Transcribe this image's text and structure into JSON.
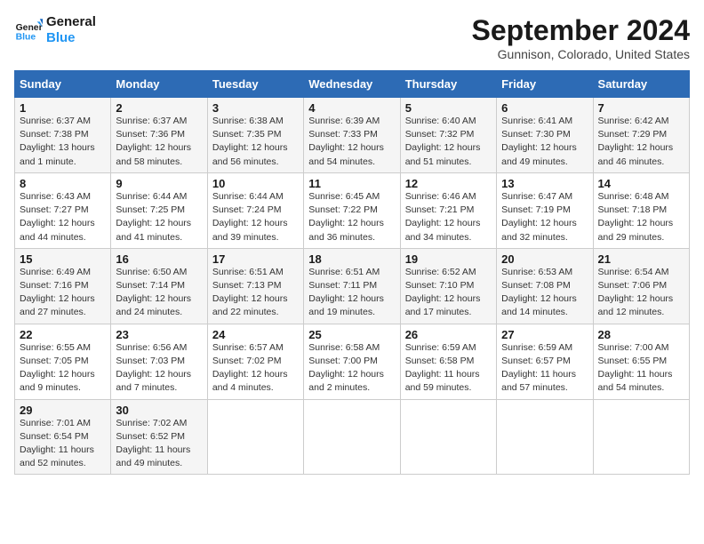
{
  "header": {
    "logo_general": "General",
    "logo_blue": "Blue",
    "title": "September 2024",
    "subtitle": "Gunnison, Colorado, United States"
  },
  "days_of_week": [
    "Sunday",
    "Monday",
    "Tuesday",
    "Wednesday",
    "Thursday",
    "Friday",
    "Saturday"
  ],
  "weeks": [
    [
      {
        "num": "1",
        "sunrise": "Sunrise: 6:37 AM",
        "sunset": "Sunset: 7:38 PM",
        "daylight": "Daylight: 13 hours and 1 minute."
      },
      {
        "num": "2",
        "sunrise": "Sunrise: 6:37 AM",
        "sunset": "Sunset: 7:36 PM",
        "daylight": "Daylight: 12 hours and 58 minutes."
      },
      {
        "num": "3",
        "sunrise": "Sunrise: 6:38 AM",
        "sunset": "Sunset: 7:35 PM",
        "daylight": "Daylight: 12 hours and 56 minutes."
      },
      {
        "num": "4",
        "sunrise": "Sunrise: 6:39 AM",
        "sunset": "Sunset: 7:33 PM",
        "daylight": "Daylight: 12 hours and 54 minutes."
      },
      {
        "num": "5",
        "sunrise": "Sunrise: 6:40 AM",
        "sunset": "Sunset: 7:32 PM",
        "daylight": "Daylight: 12 hours and 51 minutes."
      },
      {
        "num": "6",
        "sunrise": "Sunrise: 6:41 AM",
        "sunset": "Sunset: 7:30 PM",
        "daylight": "Daylight: 12 hours and 49 minutes."
      },
      {
        "num": "7",
        "sunrise": "Sunrise: 6:42 AM",
        "sunset": "Sunset: 7:29 PM",
        "daylight": "Daylight: 12 hours and 46 minutes."
      }
    ],
    [
      {
        "num": "8",
        "sunrise": "Sunrise: 6:43 AM",
        "sunset": "Sunset: 7:27 PM",
        "daylight": "Daylight: 12 hours and 44 minutes."
      },
      {
        "num": "9",
        "sunrise": "Sunrise: 6:44 AM",
        "sunset": "Sunset: 7:25 PM",
        "daylight": "Daylight: 12 hours and 41 minutes."
      },
      {
        "num": "10",
        "sunrise": "Sunrise: 6:44 AM",
        "sunset": "Sunset: 7:24 PM",
        "daylight": "Daylight: 12 hours and 39 minutes."
      },
      {
        "num": "11",
        "sunrise": "Sunrise: 6:45 AM",
        "sunset": "Sunset: 7:22 PM",
        "daylight": "Daylight: 12 hours and 36 minutes."
      },
      {
        "num": "12",
        "sunrise": "Sunrise: 6:46 AM",
        "sunset": "Sunset: 7:21 PM",
        "daylight": "Daylight: 12 hours and 34 minutes."
      },
      {
        "num": "13",
        "sunrise": "Sunrise: 6:47 AM",
        "sunset": "Sunset: 7:19 PM",
        "daylight": "Daylight: 12 hours and 32 minutes."
      },
      {
        "num": "14",
        "sunrise": "Sunrise: 6:48 AM",
        "sunset": "Sunset: 7:18 PM",
        "daylight": "Daylight: 12 hours and 29 minutes."
      }
    ],
    [
      {
        "num": "15",
        "sunrise": "Sunrise: 6:49 AM",
        "sunset": "Sunset: 7:16 PM",
        "daylight": "Daylight: 12 hours and 27 minutes."
      },
      {
        "num": "16",
        "sunrise": "Sunrise: 6:50 AM",
        "sunset": "Sunset: 7:14 PM",
        "daylight": "Daylight: 12 hours and 24 minutes."
      },
      {
        "num": "17",
        "sunrise": "Sunrise: 6:51 AM",
        "sunset": "Sunset: 7:13 PM",
        "daylight": "Daylight: 12 hours and 22 minutes."
      },
      {
        "num": "18",
        "sunrise": "Sunrise: 6:51 AM",
        "sunset": "Sunset: 7:11 PM",
        "daylight": "Daylight: 12 hours and 19 minutes."
      },
      {
        "num": "19",
        "sunrise": "Sunrise: 6:52 AM",
        "sunset": "Sunset: 7:10 PM",
        "daylight": "Daylight: 12 hours and 17 minutes."
      },
      {
        "num": "20",
        "sunrise": "Sunrise: 6:53 AM",
        "sunset": "Sunset: 7:08 PM",
        "daylight": "Daylight: 12 hours and 14 minutes."
      },
      {
        "num": "21",
        "sunrise": "Sunrise: 6:54 AM",
        "sunset": "Sunset: 7:06 PM",
        "daylight": "Daylight: 12 hours and 12 minutes."
      }
    ],
    [
      {
        "num": "22",
        "sunrise": "Sunrise: 6:55 AM",
        "sunset": "Sunset: 7:05 PM",
        "daylight": "Daylight: 12 hours and 9 minutes."
      },
      {
        "num": "23",
        "sunrise": "Sunrise: 6:56 AM",
        "sunset": "Sunset: 7:03 PM",
        "daylight": "Daylight: 12 hours and 7 minutes."
      },
      {
        "num": "24",
        "sunrise": "Sunrise: 6:57 AM",
        "sunset": "Sunset: 7:02 PM",
        "daylight": "Daylight: 12 hours and 4 minutes."
      },
      {
        "num": "25",
        "sunrise": "Sunrise: 6:58 AM",
        "sunset": "Sunset: 7:00 PM",
        "daylight": "Daylight: 12 hours and 2 minutes."
      },
      {
        "num": "26",
        "sunrise": "Sunrise: 6:59 AM",
        "sunset": "Sunset: 6:58 PM",
        "daylight": "Daylight: 11 hours and 59 minutes."
      },
      {
        "num": "27",
        "sunrise": "Sunrise: 6:59 AM",
        "sunset": "Sunset: 6:57 PM",
        "daylight": "Daylight: 11 hours and 57 minutes."
      },
      {
        "num": "28",
        "sunrise": "Sunrise: 7:00 AM",
        "sunset": "Sunset: 6:55 PM",
        "daylight": "Daylight: 11 hours and 54 minutes."
      }
    ],
    [
      {
        "num": "29",
        "sunrise": "Sunrise: 7:01 AM",
        "sunset": "Sunset: 6:54 PM",
        "daylight": "Daylight: 11 hours and 52 minutes."
      },
      {
        "num": "30",
        "sunrise": "Sunrise: 7:02 AM",
        "sunset": "Sunset: 6:52 PM",
        "daylight": "Daylight: 11 hours and 49 minutes."
      },
      null,
      null,
      null,
      null,
      null
    ]
  ]
}
